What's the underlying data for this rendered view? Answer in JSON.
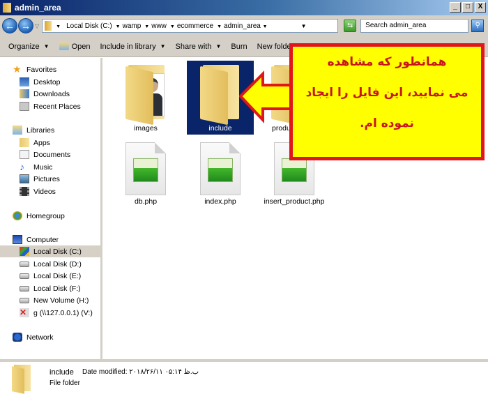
{
  "window": {
    "title": "admin_area",
    "minimize": "_",
    "maximize": "□",
    "close": "X"
  },
  "address": {
    "back_icon": "back-arrow-icon",
    "forward_icon": "forward-arrow-icon",
    "crumbs": [
      "Local Disk (C:)",
      "wamp",
      "www",
      "ecommerce",
      "admin_area"
    ],
    "search_placeholder": "Search admin_area"
  },
  "toolbar": {
    "organize": "Organize",
    "open": "Open",
    "include_in_library": "Include in library",
    "share_with": "Share with",
    "burn": "Burn",
    "new_folder": "New folder"
  },
  "sidebar": {
    "favorites": "Favorites",
    "favorites_items": [
      "Desktop",
      "Downloads",
      "Recent Places"
    ],
    "libraries": "Libraries",
    "libraries_items": [
      "Apps",
      "Documents",
      "Music",
      "Pictures",
      "Videos"
    ],
    "homegroup": "Homegroup",
    "computer": "Computer",
    "computer_items": [
      "Local Disk (C:)",
      "Local Disk (D:)",
      "Local Disk (E:)",
      "Local Disk (F:)",
      "New Volume (H:)",
      "g (\\\\127.0.0.1) (V:)"
    ],
    "network": "Network",
    "selected": "Local Disk (C:)"
  },
  "files": [
    {
      "name": "images",
      "type": "folder-with-user"
    },
    {
      "name": "include",
      "type": "folder",
      "selected": true
    },
    {
      "name": "produ",
      "type": "folder"
    },
    {
      "name": "db.php",
      "type": "php"
    },
    {
      "name": "index.php",
      "type": "php"
    },
    {
      "name": "insert_product.php",
      "type": "php"
    }
  ],
  "callout": {
    "line1": "همانطور که مشاهده",
    "line2": "می نمایید، این فایل را ایجاد",
    "line3": "نموده ام.",
    "bg_color": "#ffff00",
    "border_color": "#e0161b",
    "text_color": "#c8161b"
  },
  "status": {
    "name": "include",
    "date_modified": "Date modified: ۲۰۱۸/۲۶/۱۱ ب.ظ ۰۵:۱۴",
    "type": "File folder"
  }
}
